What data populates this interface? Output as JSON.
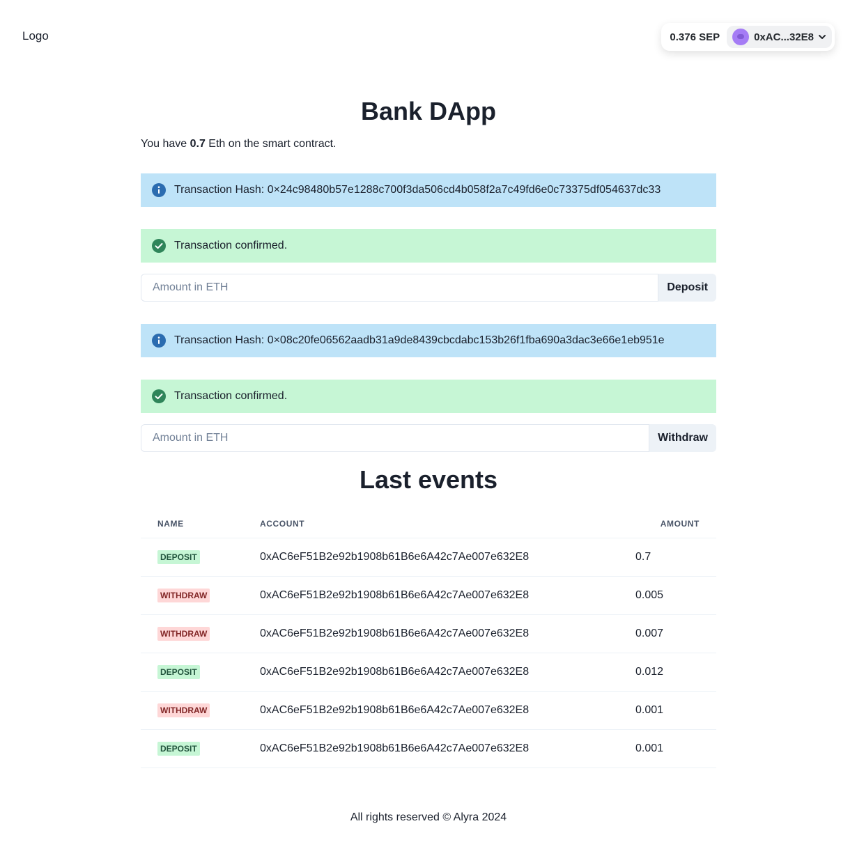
{
  "header": {
    "logo": "Logo",
    "wallet_balance": "0.376 SEP",
    "account_short": "0xAC...32E8"
  },
  "main": {
    "title": "Bank DApp",
    "balance_prefix": "You have",
    "balance_value": "0.7",
    "balance_suffix": "Eth on the smart contract."
  },
  "deposit": {
    "info_alert": "Transaction Hash: 0×24c98480b57e1288c700f3da506cd4b058f2a7c49fd6e0c73375df054637dc33",
    "success_alert": "Transaction confirmed.",
    "input_placeholder": "Amount in ETH",
    "button_label": "Deposit"
  },
  "withdraw": {
    "info_alert": "Transaction Hash: 0×08c20fe06562aadb31a9de8439cbcdabc153b26f1fba690a3dac3e66e1eb951e",
    "success_alert": "Transaction confirmed.",
    "input_placeholder": "Amount in ETH",
    "button_label": "Withdraw"
  },
  "events": {
    "title": "Last events",
    "columns": [
      "NAME",
      "ACCOUNT",
      "AMOUNT"
    ],
    "rows": [
      {
        "name": "DEPOSIT",
        "account": "0xAC6eF51B2e92b1908b61B6e6A42c7Ae007e632E8",
        "amount": "0.7"
      },
      {
        "name": "WITHDRAW",
        "account": "0xAC6eF51B2e92b1908b61B6e6A42c7Ae007e632E8",
        "amount": "0.005"
      },
      {
        "name": "WITHDRAW",
        "account": "0xAC6eF51B2e92b1908b61B6e6A42c7Ae007e632E8",
        "amount": "0.007"
      },
      {
        "name": "DEPOSIT",
        "account": "0xAC6eF51B2e92b1908b61B6e6A42c7Ae007e632E8",
        "amount": "0.012"
      },
      {
        "name": "WITHDRAW",
        "account": "0xAC6eF51B2e92b1908b61B6e6A42c7Ae007e632E8",
        "amount": "0.001"
      },
      {
        "name": "DEPOSIT",
        "account": "0xAC6eF51B2e92b1908b61B6e6A42c7Ae007e632E8",
        "amount": "0.001"
      }
    ]
  },
  "footer": {
    "text": "All rights reserved © Alyra 2024"
  },
  "colors": {
    "info_bg": "#bee3f8",
    "success_bg": "#c6f6d5",
    "info_icon": "#2b6cb0",
    "success_icon": "#2f855a",
    "deposit_badge_bg": "#c6f6d5",
    "withdraw_badge_bg": "#fed7d7",
    "avatar": "#a57cf5"
  },
  "icons": {
    "info": "info-circle-icon",
    "success": "check-circle-icon",
    "chevron": "chevron-down-icon"
  }
}
